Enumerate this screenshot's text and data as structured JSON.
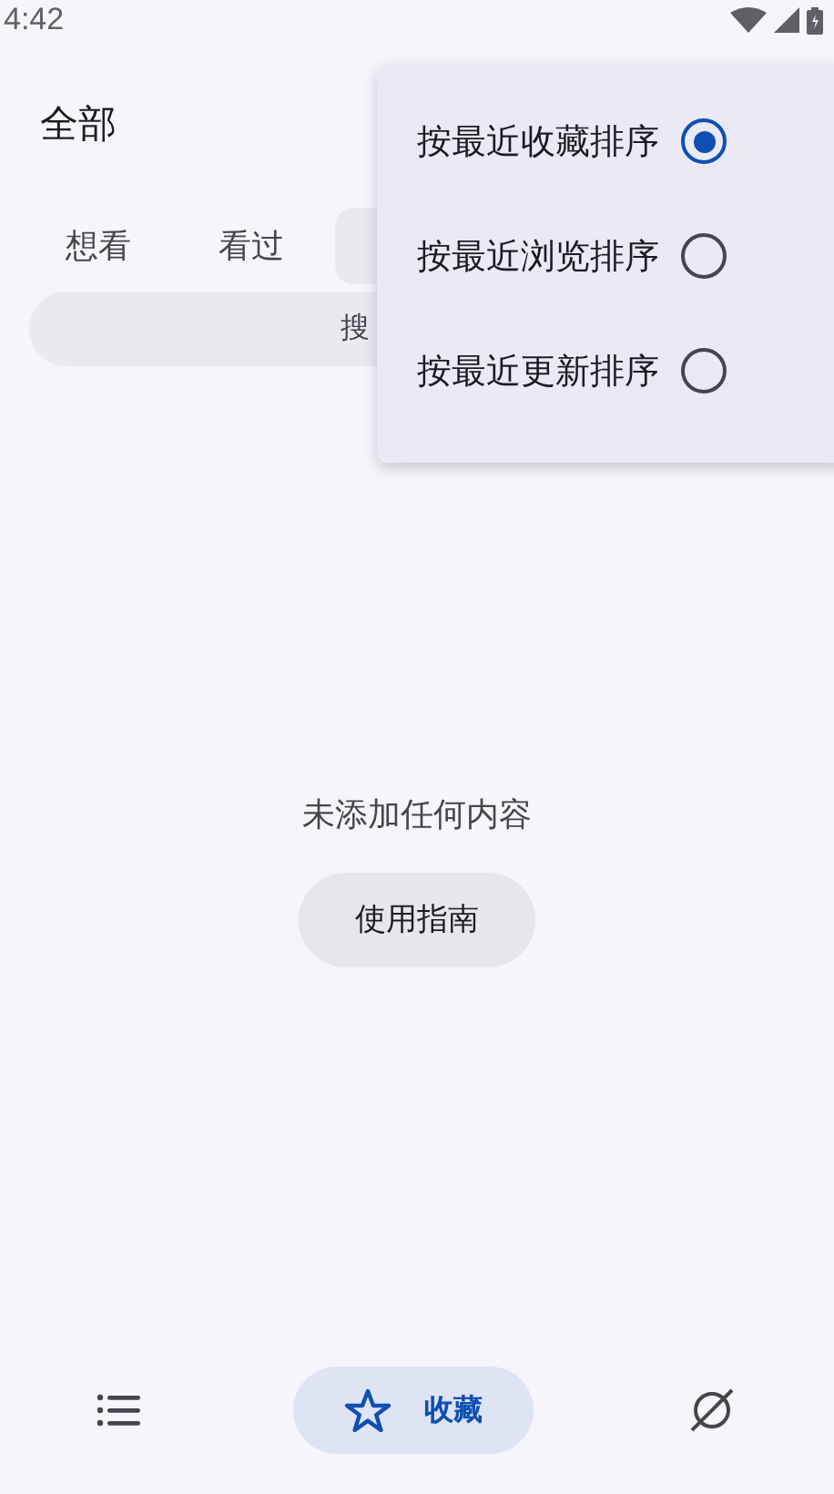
{
  "status_bar": {
    "time": "4:42"
  },
  "header": {
    "title": "全部"
  },
  "tabs": [
    {
      "label": "想看",
      "selected": false
    },
    {
      "label": "看过",
      "selected": false
    },
    {
      "selected": true
    }
  ],
  "search": {
    "placeholder": "搜"
  },
  "empty": {
    "message": "未添加任何内容",
    "button": "使用指南"
  },
  "sort_menu": [
    {
      "label": "按最近收藏排序",
      "selected": true
    },
    {
      "label": "按最近浏览排序",
      "selected": false
    },
    {
      "label": "按最近更新排序",
      "selected": false
    }
  ],
  "bottom_nav": [
    {
      "kind": "list",
      "selected": false
    },
    {
      "kind": "star",
      "label": "收藏",
      "selected": true
    },
    {
      "kind": "planet",
      "selected": false
    }
  ]
}
